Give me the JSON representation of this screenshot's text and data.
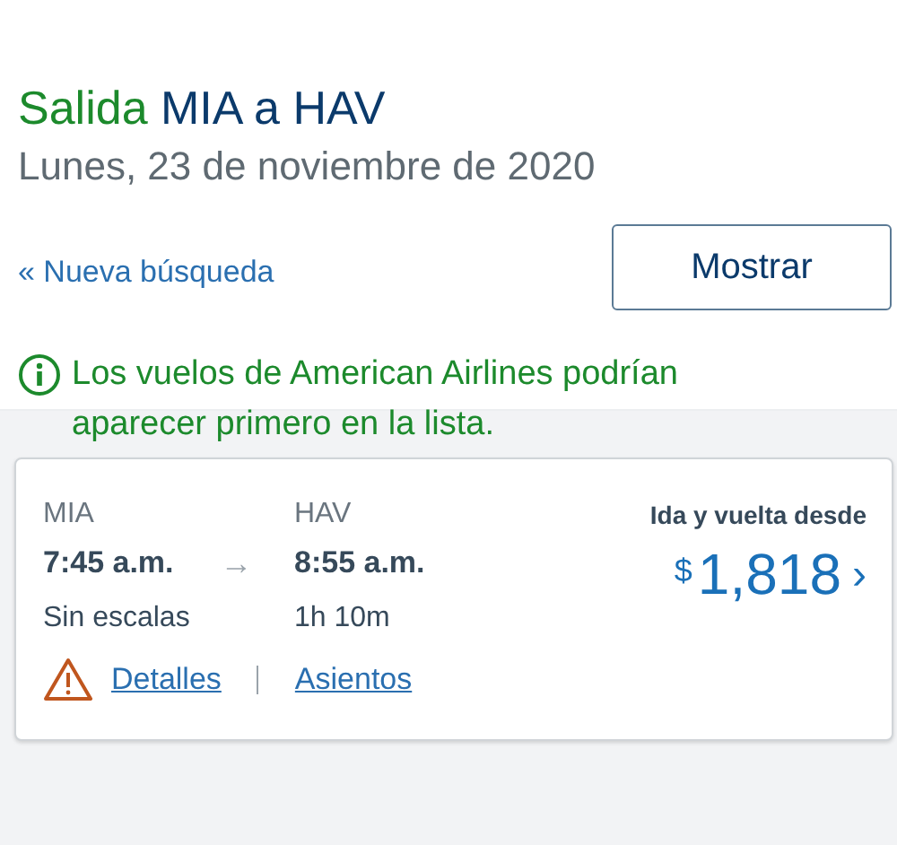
{
  "header": {
    "label": "Salida",
    "route": "MIA a HAV",
    "date": "Lunes, 23 de noviembre de 2020"
  },
  "actions": {
    "link": "« Nueva búsqueda",
    "button": "Mostrar"
  },
  "notice": {
    "text": "Los vuelos de American Airlines podrían aparecer primero en la lista."
  },
  "flights": [
    {
      "origin": "MIA",
      "destination": "HAV",
      "depart": "7:45 a.m.",
      "arrow": "→",
      "arrive": "8:55 a.m.",
      "stops": "Sin escalas",
      "duration": "1h  10m",
      "warning": true,
      "links": [
        "Detalles",
        "Asientos"
      ],
      "price_label": "Ida y vuelta desde",
      "currency": "$",
      "amount": "1,818",
      "chevron": "›"
    }
  ]
}
